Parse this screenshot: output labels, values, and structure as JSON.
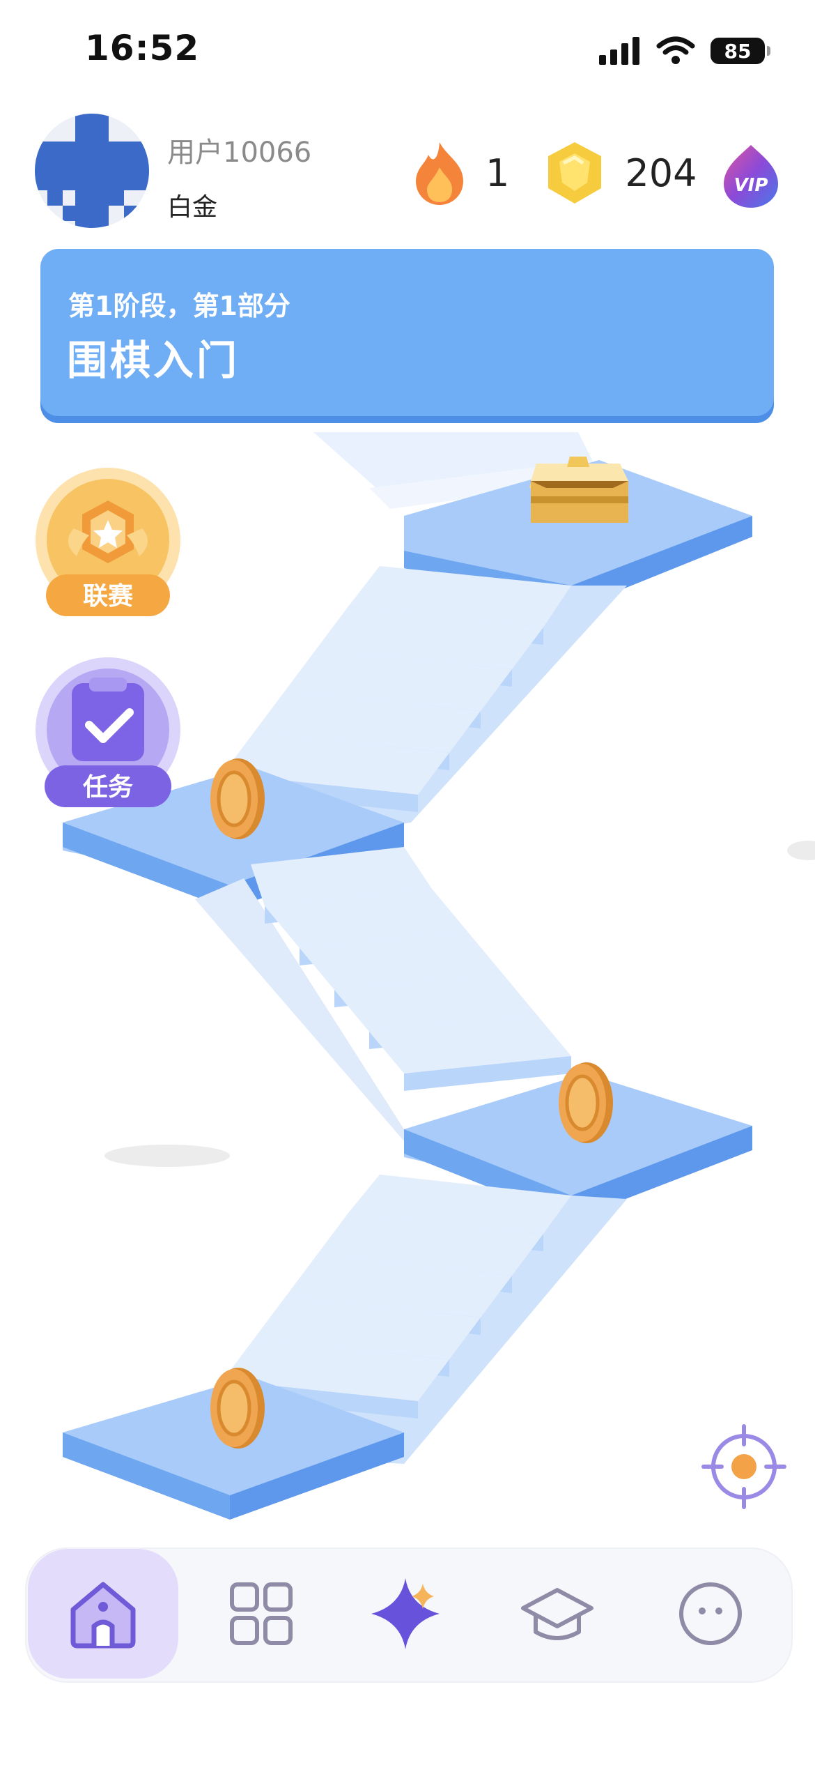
{
  "status_bar": {
    "time": "16:52",
    "battery": "85"
  },
  "user": {
    "name": "用户10066",
    "rank": "白金"
  },
  "stats": {
    "streak": "1",
    "gems": "204"
  },
  "vip_label": "VIP",
  "banner": {
    "subtitle": "第1阶段，第1部分",
    "title": "围棋入门"
  },
  "side_buttons": {
    "league": "联赛",
    "tasks": "任务"
  },
  "nav": {
    "items": [
      {
        "name": "home",
        "icon": "home-icon",
        "active": true
      },
      {
        "name": "grid",
        "icon": "grid-icon",
        "active": false
      },
      {
        "name": "sparkle",
        "icon": "sparkle-icon",
        "active": false
      },
      {
        "name": "learn",
        "icon": "graduation-cap-icon",
        "active": false
      },
      {
        "name": "profile",
        "icon": "face-icon",
        "active": false
      }
    ]
  },
  "colors": {
    "accent": "#6fadf5",
    "nav_active": "#e3dcfb",
    "coin": "#f0a650"
  }
}
